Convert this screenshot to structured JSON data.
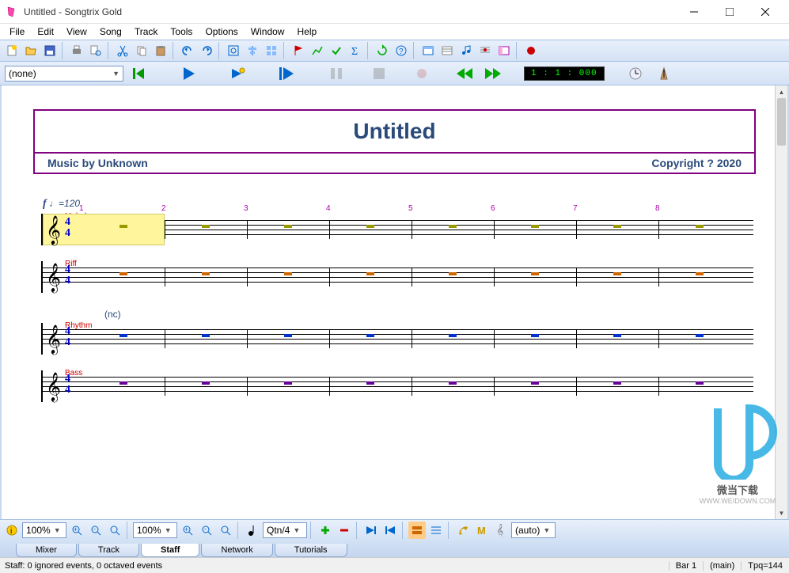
{
  "window": {
    "title": "Untitled - Songtrix Gold"
  },
  "menu": {
    "items": [
      "File",
      "Edit",
      "View",
      "Song",
      "Track",
      "Tools",
      "Options",
      "Window",
      "Help"
    ]
  },
  "transport": {
    "preset": "(none)",
    "counter": "1 : 1 : 000"
  },
  "score": {
    "title": "Untitled",
    "music_by": "Music by Unknown",
    "copyright": "Copyright ? 2020",
    "tempo_mark": "f",
    "tempo_value": "=120",
    "nc_label": "(nc)",
    "bar_numbers": [
      "1",
      "2",
      "3",
      "4",
      "5",
      "6",
      "7",
      "8"
    ],
    "tracks": [
      {
        "name": "Melody",
        "color": "#999900",
        "highlighted": true
      },
      {
        "name": "Riff",
        "color": "#cc6600",
        "highlighted": false
      },
      {
        "name": "Rhythm",
        "color": "#0033cc",
        "highlighted": false
      },
      {
        "name": "Bass",
        "color": "#660099",
        "highlighted": false
      }
    ]
  },
  "bottom": {
    "zoom1": "100%",
    "zoom2": "100%",
    "quantize": "Qtn/4",
    "auto": "(auto)"
  },
  "tabs": {
    "items": [
      "Mixer",
      "Track",
      "Staff",
      "Network",
      "Tutorials"
    ],
    "active": "Staff"
  },
  "status": {
    "left": "Staff: 0 ignored events, 0 octaved events",
    "bar": "Bar 1",
    "layer": "(main)",
    "tpq": "Tpq=144"
  },
  "watermark": {
    "brand": "微当下载",
    "url": "WWW.WEIDOWN.COM"
  }
}
